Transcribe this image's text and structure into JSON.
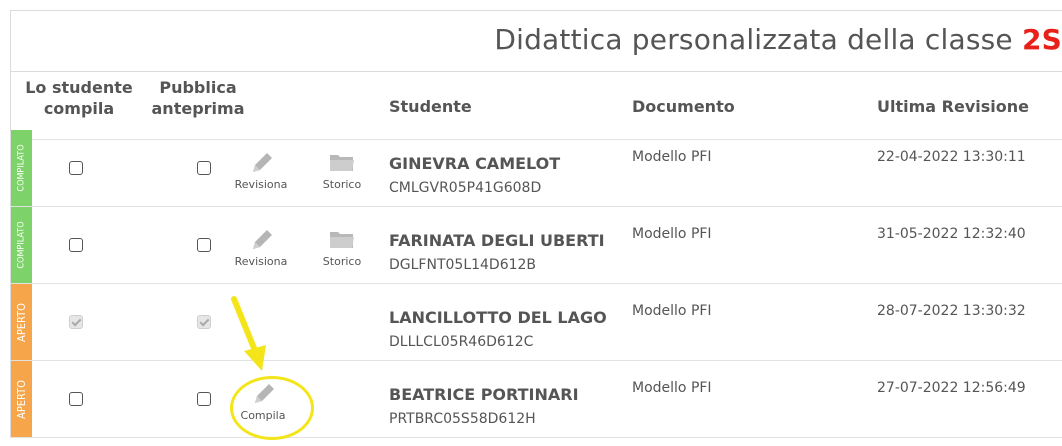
{
  "page": {
    "title_prefix": "Didattica personalizzata della classe",
    "class_name": "2S"
  },
  "columns": {
    "student_compiles": "Lo studente compila",
    "publish_preview": "Pubblica anteprima",
    "student": "Studente",
    "document": "Documento",
    "last_revision": "Ultima Revisione"
  },
  "action_labels": {
    "revise": "Revisiona",
    "history": "Storico",
    "fill": "Compila"
  },
  "rows": [
    {
      "status": "COMPILATO",
      "student_compiles_checked": false,
      "publish_preview_checked": false,
      "actions": [
        "revise",
        "history"
      ],
      "name": "GINEVRA CAMELOT",
      "code": "CMLGVR05P41G608D",
      "document": "Modello PFI",
      "last_revision": "22-04-2022 13:30:11"
    },
    {
      "status": "COMPILATO",
      "student_compiles_checked": false,
      "publish_preview_checked": false,
      "actions": [
        "revise",
        "history"
      ],
      "name": "FARINATA DEGLI UBERTI",
      "code": "DGLFNT05L14D612B",
      "document": "Modello PFI",
      "last_revision": "31-05-2022 12:32:40"
    },
    {
      "status": "APERTO",
      "student_compiles_checked": true,
      "publish_preview_checked": true,
      "actions": [],
      "name": "LANCILLOTTO DEL LAGO",
      "code": "DLLLCL05R46D612C",
      "document": "Modello PFI",
      "last_revision": "28-07-2022 13:30:32"
    },
    {
      "status": "APERTO",
      "student_compiles_checked": false,
      "publish_preview_checked": false,
      "actions": [
        "fill"
      ],
      "name": "BEATRICE PORTINARI",
      "code": "PRTBRC05S58D612H",
      "document": "Modello PFI",
      "last_revision": "27-07-2022 12:56:49"
    }
  ],
  "colors": {
    "status_compilato": "#7dd36a",
    "status_aperto": "#f6a54a",
    "class_highlight": "#e8201a",
    "annotation": "#f4e51a"
  },
  "icons": {
    "revise": "pencil-icon",
    "history": "folder-icon",
    "fill": "pencil-icon",
    "annotation": "arrow-down-icon"
  }
}
